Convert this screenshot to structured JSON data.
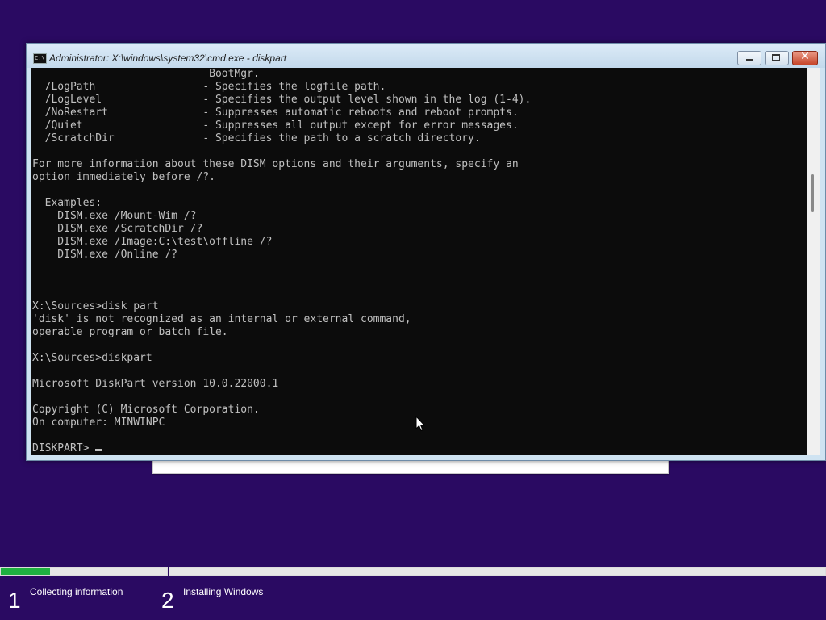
{
  "window": {
    "title": "Administrator: X:\\windows\\system32\\cmd.exe - diskpart",
    "icon": "cmd-icon",
    "icon_text": "C:\\",
    "controls": [
      "minimize",
      "maximize",
      "close"
    ]
  },
  "console": {
    "text": "                            BootMgr.\n  /LogPath                 - Specifies the logfile path.\n  /LogLevel                - Specifies the output level shown in the log (1-4).\n  /NoRestart               - Suppresses automatic reboots and reboot prompts.\n  /Quiet                   - Suppresses all output except for error messages.\n  /ScratchDir              - Specifies the path to a scratch directory.\n\nFor more information about these DISM options and their arguments, specify an\noption immediately before /?.\n\n  Examples:\n    DISM.exe /Mount-Wim /?\n    DISM.exe /ScratchDir /?\n    DISM.exe /Image:C:\\test\\offline /?\n    DISM.exe /Online /?\n\n\n\nX:\\Sources>disk part\n'disk' is not recognized as an internal or external command,\noperable program or batch file.\n\nX:\\Sources>diskpart\n\nMicrosoft DiskPart version 10.0.22000.1\n\nCopyright (C) Microsoft Corporation.\nOn computer: MINWINPC\n\n",
    "prompt": "DISKPART> "
  },
  "setup": {
    "progress": 0.06,
    "steps": [
      {
        "number": "1",
        "label": "Collecting information"
      },
      {
        "number": "2",
        "label": "Installing Windows"
      }
    ]
  },
  "colors": {
    "background": "#2a0a62",
    "progress_fill": "#1fb141",
    "console_bg": "#0c0c0c",
    "console_fg": "#c0c0c0"
  }
}
